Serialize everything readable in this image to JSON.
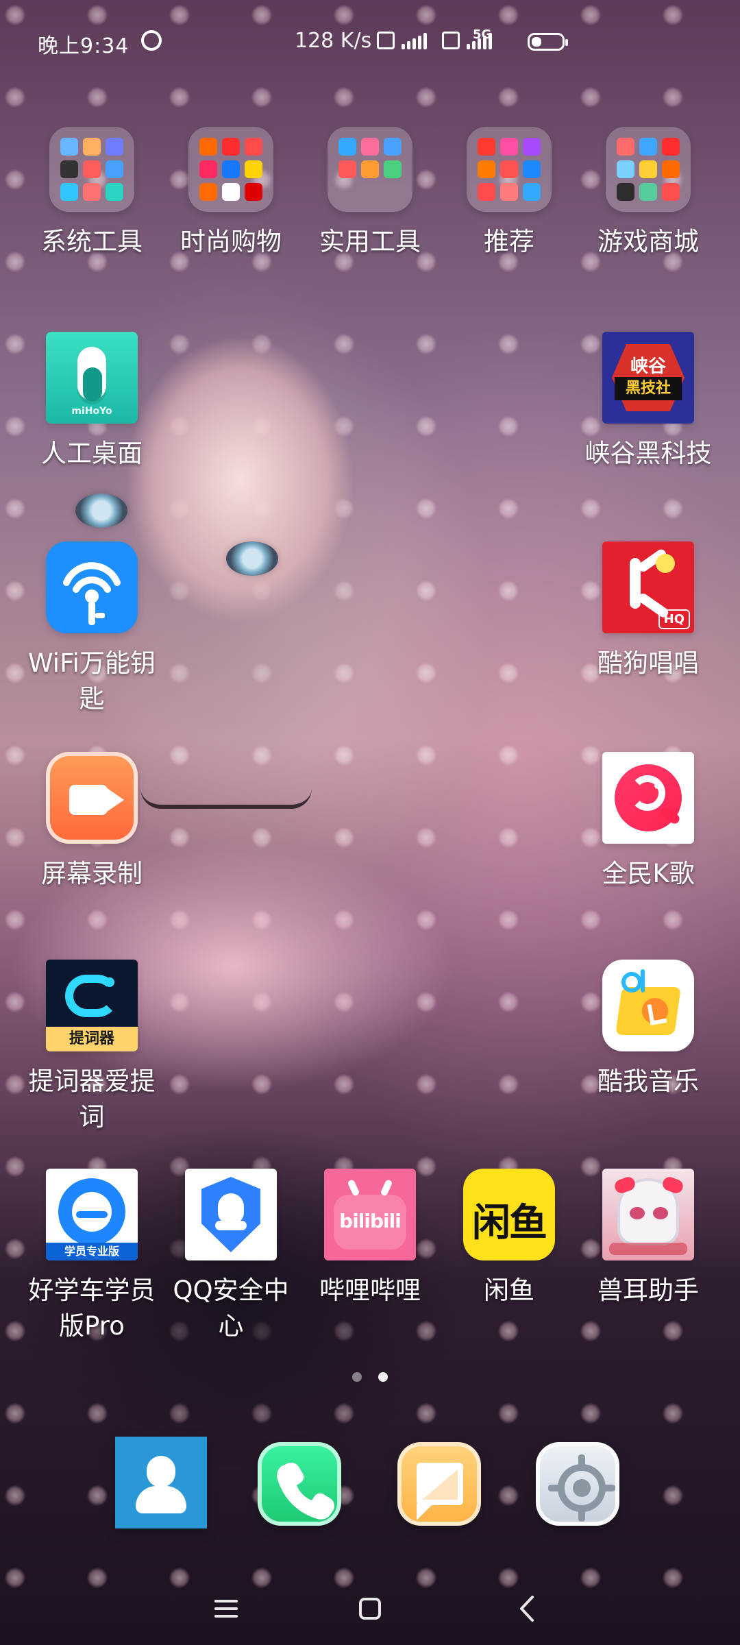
{
  "statusbar": {
    "time": "晚上9:34",
    "network_speed": "128 K/s",
    "network_type": "5G"
  },
  "grid": {
    "folders": [
      {
        "label": "系统工具"
      },
      {
        "label": "时尚购物"
      },
      {
        "label": "实用工具"
      },
      {
        "label": "推荐"
      },
      {
        "label": "游戏商城"
      }
    ],
    "apps_left": [
      {
        "label": "人工桌面",
        "icon_name": "mihoyo-ai-desktop-icon",
        "icon_text": "miHoYo"
      },
      {
        "label": "WiFi万能钥匙",
        "icon_name": "wifi-key-icon"
      },
      {
        "label": "屏幕录制",
        "icon_name": "screen-record-icon"
      },
      {
        "label": "提词器爱提词",
        "icon_name": "teleprompter-icon",
        "icon_text": "提词器"
      }
    ],
    "apps_right": [
      {
        "label": "峡谷黑科技",
        "icon_name": "canyon-tech-icon",
        "icon_text_1": "峡谷",
        "icon_text_2": "黑技社"
      },
      {
        "label": "酷狗唱唱",
        "icon_name": "kugou-sing-icon",
        "icon_badge": "HQ"
      },
      {
        "label": "全民K歌",
        "icon_name": "wesing-icon"
      },
      {
        "label": "酷我音乐",
        "icon_name": "kuwo-music-icon"
      }
    ],
    "bottom_row": [
      {
        "label": "好学车学员版Pro",
        "icon_name": "haoxueche-icon",
        "icon_text": "学员专业版"
      },
      {
        "label": "QQ安全中心",
        "icon_name": "qq-security-icon"
      },
      {
        "label": "哔哩哔哩",
        "icon_name": "bilibili-icon",
        "icon_text": "bilibili"
      },
      {
        "label": "闲鱼",
        "icon_name": "xianyu-icon",
        "icon_text": "闲鱼"
      },
      {
        "label": "兽耳助手",
        "icon_name": "shouer-assistant-icon"
      }
    ]
  },
  "page_indicator": {
    "pages": 2,
    "current": 2
  },
  "dock": {
    "items": [
      {
        "icon_name": "contacts-icon"
      },
      {
        "icon_name": "phone-icon"
      },
      {
        "icon_name": "messages-icon"
      },
      {
        "icon_name": "settings-icon"
      }
    ]
  },
  "colors": {
    "wifi_key_blue": "#1e8fff",
    "screen_record_orange": "#ff7a45",
    "kugou_red": "#e5202e",
    "bilibili_pink": "#f76799",
    "xianyu_yellow": "#ffe11a",
    "contacts_blue": "#2a98d7",
    "phone_green": "#2fd482",
    "messages_orange": "#ffb347"
  }
}
